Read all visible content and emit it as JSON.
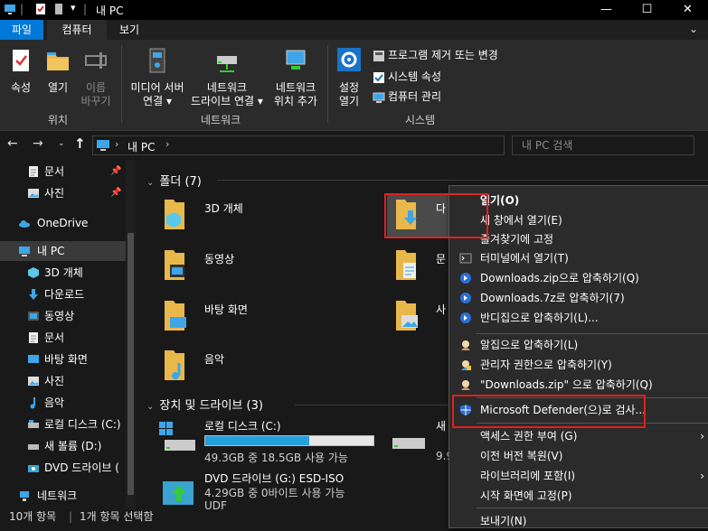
{
  "window": {
    "title": "내 PC",
    "minimize": "—",
    "maximize": "☐",
    "close": "✕"
  },
  "ribbon_tabs": {
    "file": "파일",
    "computer": "컴퓨터",
    "view": "보기"
  },
  "ribbon": {
    "location": {
      "properties": "속성",
      "open": "열기",
      "rename_1": "이름",
      "rename_2": "바꾸기",
      "group": "위치"
    },
    "network": {
      "media_1": "미디어 서버",
      "media_2": "연결",
      "map_1": "네트워크",
      "map_2": "드라이브 연결",
      "add_1": "네트워크",
      "add_2": "위치 추가",
      "group": "네트워크"
    },
    "system": {
      "settings_1": "설정",
      "settings_2": "열기",
      "uninstall": "프로그램 제거 또는 변경",
      "sysprops": "시스템 속성",
      "manage": "컴퓨터 관리",
      "group": "시스템"
    }
  },
  "address": {
    "path_root": "내 PC",
    "search_placeholder": "내 PC 검색"
  },
  "nav": {
    "items": [
      {
        "label": "문서",
        "pinned": true
      },
      {
        "label": "사진",
        "pinned": true
      },
      {
        "label": "OneDrive"
      },
      {
        "label": "내 PC"
      },
      {
        "label": "3D 개체"
      },
      {
        "label": "다운로드"
      },
      {
        "label": "동영상"
      },
      {
        "label": "문서"
      },
      {
        "label": "바탕 화면"
      },
      {
        "label": "사진"
      },
      {
        "label": "음악"
      },
      {
        "label": "로컬 디스크 (C:)"
      },
      {
        "label": "새 볼륨 (D:)"
      },
      {
        "label": "DVD 드라이브 ("
      },
      {
        "label": "네트워크"
      }
    ]
  },
  "content": {
    "folders_header": "폴더 (7)",
    "folders": [
      {
        "label": "3D 개체"
      },
      {
        "label": "다"
      },
      {
        "label": "동영상"
      },
      {
        "label": "문"
      },
      {
        "label": "바탕 화면"
      },
      {
        "label": "사"
      },
      {
        "label": "음악"
      }
    ],
    "drives_header": "장치 및 드라이브 (3)",
    "drives": [
      {
        "name": "로컬 디스크 (C:)",
        "info": "49.3GB 중 18.5GB 사용 가능",
        "used_fraction": 0.62
      },
      {
        "name": "새",
        "info": "9.9"
      },
      {
        "name": "DVD 드라이브 (G:) ESD-ISO",
        "info": "4.29GB 중 0바이트 사용 가능",
        "extra": "UDF"
      }
    ]
  },
  "status": {
    "count": "10개 항목",
    "selected": "1개 항목 선택함"
  },
  "context_menu": {
    "items": [
      {
        "label": "열기(O)",
        "bold": true
      },
      {
        "label": "새 창에서 열기(E)"
      },
      {
        "label": "즐겨찾기에 고정"
      },
      {
        "label": "터미널에서 열기(T)"
      },
      {
        "label": "Downloads.zip으로 압축하기(Q)"
      },
      {
        "label": "Downloads.7z로 압축하기(7)"
      },
      {
        "label": "반디집으로 압축하기(L)..."
      },
      {
        "label": "알집으로 압축하기(L)"
      },
      {
        "label": "관리자 권한으로 압축하기(Y)"
      },
      {
        "label": "\"Downloads.zip\" 으로 압축하기(Q)"
      },
      {
        "label": "Microsoft Defender(으)로 검사..."
      },
      {
        "label": "액세스 권한 부여 (G)"
      },
      {
        "label": "이전 버전 복원(V)"
      },
      {
        "label": "라이브러리에 포함(I)"
      },
      {
        "label": "시작 화면에 고정(P)"
      },
      {
        "label": "보내기(N)"
      }
    ],
    "submenu_arrow": "›"
  },
  "colors": {
    "accent": "#0078d7",
    "highlight_box": "#e02020",
    "drive_bar_fill": "#26a0da",
    "folder": "#e8b84a"
  }
}
